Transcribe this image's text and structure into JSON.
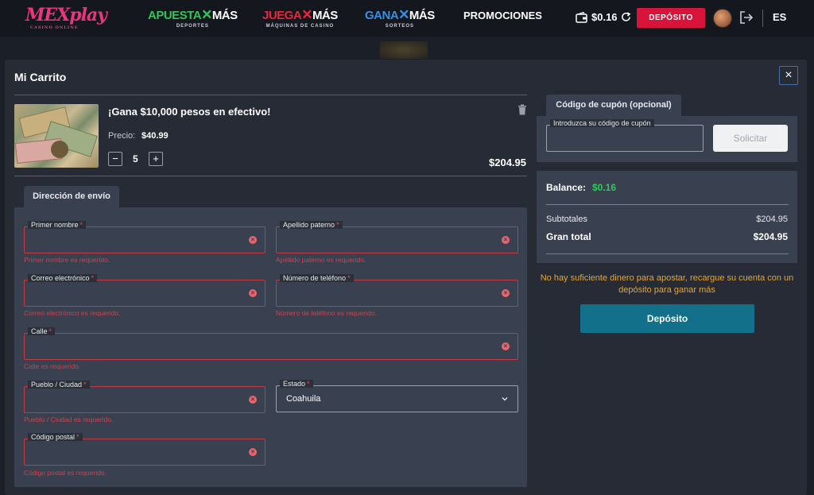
{
  "nav": {
    "logo": "MEXplay",
    "logo_sub": "CASINO ONLINE",
    "links": [
      {
        "main_a": "APUESTA",
        "main_b": "MÁS",
        "sub": "DEPORTES",
        "color": "#33c35a"
      },
      {
        "main_a": "JUEGA",
        "main_b": "MÁS",
        "sub": "MÁQUINAS DE CASINO",
        "color": "#e8283c"
      },
      {
        "main_a": "GANA",
        "main_b": "MÁS",
        "sub": "SORTEOS",
        "color": "#3a8fe0"
      }
    ],
    "promotions": "PROMOCIONES",
    "balance": "$0.16",
    "deposit_label": "DEPÓSITO",
    "language": "ES"
  },
  "modal": {
    "title": "Mi Carrito",
    "close": "×"
  },
  "product": {
    "title": "¡Gana $10,000 pesos en efectivo!",
    "price_label": "Precio:",
    "price": "$40.99",
    "quantity": "5",
    "minus": "−",
    "plus": "+",
    "line_total": "$204.95"
  },
  "address": {
    "tab": "Dirección de envío",
    "fields": {
      "first_name": {
        "label": "Primer nombre",
        "error": "Primer nombre es requerido."
      },
      "last_name": {
        "label": "Apellido paterno",
        "error": "Apellido paterno es requerido."
      },
      "email": {
        "label": "Correo electrónico",
        "error": "Correo electrónico es requerido."
      },
      "phone": {
        "label": "Número de teléfono",
        "error": "Número de teléfono es requerido."
      },
      "street": {
        "label": "Calle",
        "error": "Calle es requerido."
      },
      "city": {
        "label": "Pueblo / Ciudad",
        "error": "Pueblo / Ciudad es requerido."
      },
      "state": {
        "label": "Estado",
        "value": "Coahuila"
      },
      "postal": {
        "label": "Código postal",
        "error": "Código postal es requerido."
      }
    },
    "required_mark": "*"
  },
  "coupon": {
    "tab": "Código de cupón (opcional)",
    "input_label": "Introduzca su código de cupón",
    "button": "Solicitar"
  },
  "summary": {
    "balance_label": "Balance:",
    "balance_value": "$0.16",
    "subtotal_label": "Subtotales",
    "subtotal_value": "$204.95",
    "grand_total_label": "Gran total",
    "grand_total_value": "$204.95"
  },
  "warning": "No hay suficiente dinero para apostar, recargue su cuenta con un depósito para ganar más",
  "deposit_button": "Depósito",
  "colors": {
    "accent_red": "#d8143a",
    "error": "#c23a44",
    "positive": "#2ecc56",
    "warning": "#e6a534",
    "deposit": "#13708a"
  }
}
